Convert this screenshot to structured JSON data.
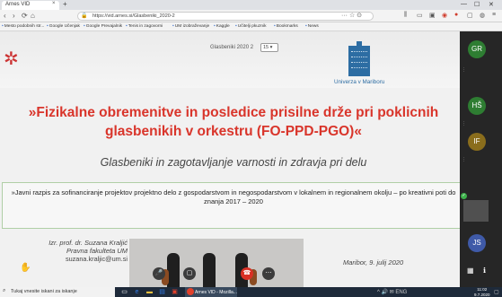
{
  "browser": {
    "tab_title": "Arnes VID",
    "tab_close": "×",
    "new_tab": "+",
    "window_controls": [
      "—",
      "☐",
      "✕"
    ],
    "nav": [
      "‹",
      "›",
      "⟳",
      "⌂"
    ],
    "url": "https://vid.arnes.si/Glasbeniki_2020-2",
    "url_actions": "··· ☆ ⊙",
    "bookmarks": [
      "Mesto podobnih str...",
      "Google Učenjak",
      "Google Prevajalnik",
      "Tenis in zagovorni",
      "UM izobraževanje",
      "Kaggle",
      "Učitelji pkuznik",
      "Bookmarks",
      "News"
    ]
  },
  "slide": {
    "counter": "Glasbeniki 2020 2",
    "page_pill": "15 ▾",
    "logo_text": "Univerza v Mariboru",
    "title": "»Fizikalne obremenitve in posledice prisilne drže pri poklicnih glasbenikih v orkestru (FO-PPD-PGO)«",
    "subtitle": "Glasbeniki in zagotavljanje varnosti in zdravja pri delu",
    "call": "»Javni razpis za sofinanciranje projektov projektno delo z gospodarstvom in negospodarstvom v lokalnem in regionalnem okolju – po kreativni poti do znanja 2017 – 2020",
    "author_name": "Izr. prof. dr. Suzana Kraljić",
    "author_affil": "Pravna fakulteta UM",
    "author_email": "suzana.kraljic@um.si",
    "date": "Maribor, 9. julij 2020"
  },
  "participants": [
    {
      "initials": "GR",
      "color": "#2e7d32"
    },
    {
      "initials": "HŠ",
      "color": "#2e7d32"
    },
    {
      "initials": "IF",
      "color": "#8a6d1c"
    },
    {
      "initials": "JS",
      "color": "#3f5aa8"
    },
    {
      "initials": "",
      "color": "#1b5e20"
    }
  ],
  "controls": {
    "hand": "✋",
    "mic": "🎤",
    "camera": "▢",
    "hangup": "☎",
    "more": "⋯",
    "panel_grid": "▦",
    "panel_info": "ℹ"
  },
  "taskbar": {
    "search_placeholder": "Tukaj vnesite iskani za iskanje",
    "search_icon": "⌕",
    "task_title": "Arnes VID - Mozilla...",
    "tray": "^ 🔊 ✉ ENG",
    "time": "11:02",
    "date": "9.7.2020"
  },
  "colors": {
    "title_red": "#d9352b",
    "um_blue": "#2d6da3",
    "call_border": "#b0cfa6",
    "hangup_red": "#d93025"
  }
}
